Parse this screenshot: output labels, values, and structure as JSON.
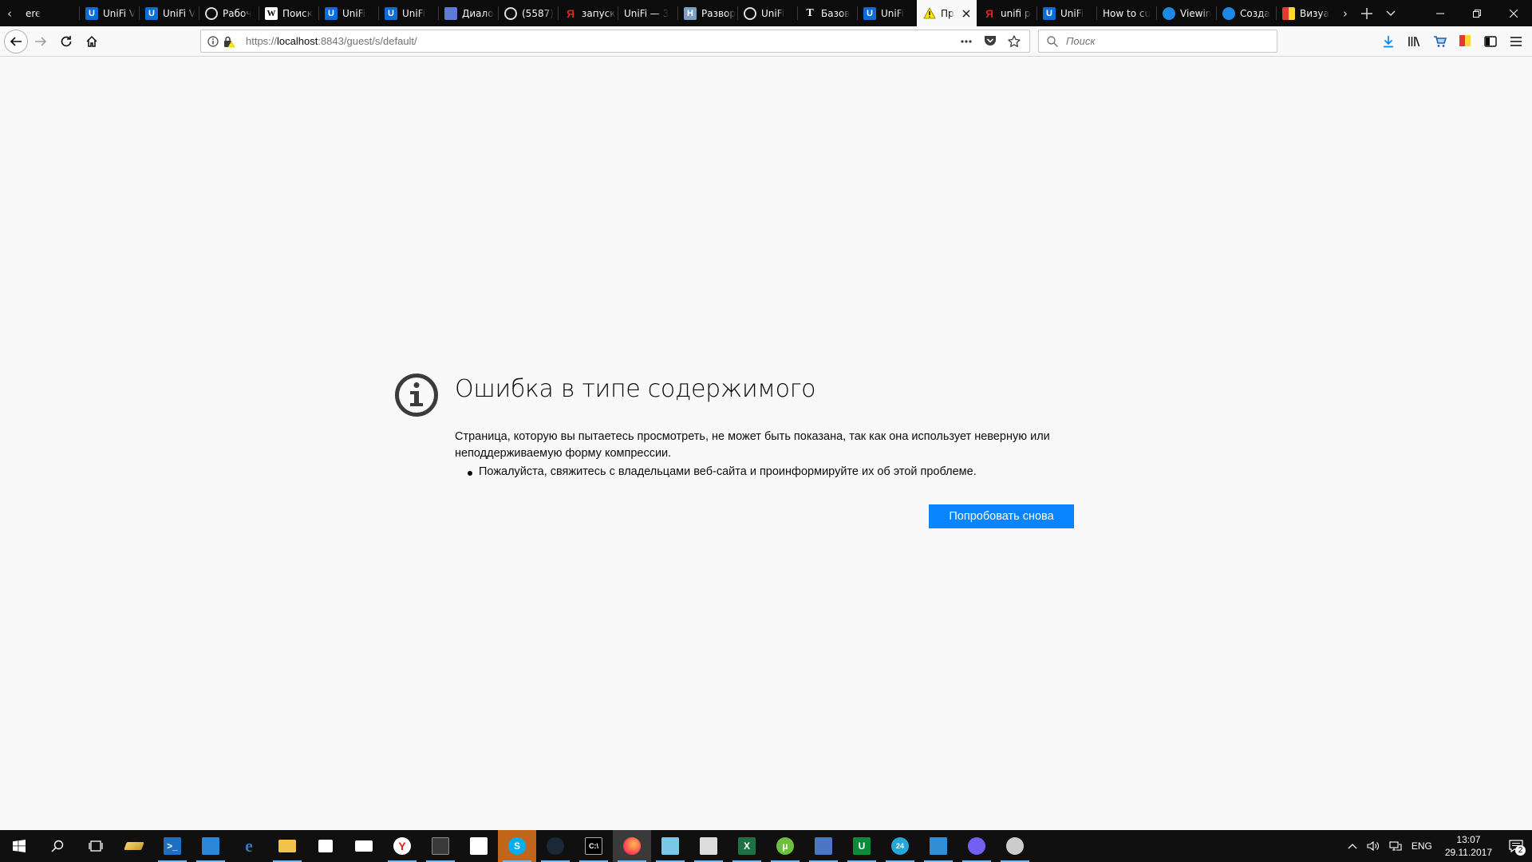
{
  "browser": {
    "tabs": [
      {
        "label": "ere",
        "icon": "none"
      },
      {
        "label": "UniFi V",
        "icon": "unifi"
      },
      {
        "label": "UniFi V",
        "icon": "unifi"
      },
      {
        "label": "Рабоч",
        "icon": "circle"
      },
      {
        "label": "Поиск",
        "icon": "w"
      },
      {
        "label": "UniFi",
        "icon": "unifi"
      },
      {
        "label": "UniFi",
        "icon": "unifi"
      },
      {
        "label": "Диало",
        "icon": "dialog"
      },
      {
        "label": "(5587)",
        "icon": "circle"
      },
      {
        "label": "запуск",
        "icon": "ya"
      },
      {
        "label": "UniFi — 3",
        "icon": "none"
      },
      {
        "label": "Развор",
        "icon": "h"
      },
      {
        "label": "UniFi",
        "icon": "circle"
      },
      {
        "label": "Базов",
        "icon": "t"
      },
      {
        "label": "UniFi",
        "icon": "unifi"
      },
      {
        "label": "Пр",
        "icon": "warn",
        "active": true
      },
      {
        "label": "unifi p",
        "icon": "ya"
      },
      {
        "label": "UniFi",
        "icon": "unifi"
      },
      {
        "label": "How to cu",
        "icon": "none"
      },
      {
        "label": "Viewin",
        "icon": "blue-round"
      },
      {
        "label": "Созда",
        "icon": "blue-round"
      },
      {
        "label": "Визуа",
        "icon": "flag"
      }
    ],
    "url": {
      "prefix": "https://",
      "host": "localhost",
      "rest": ":8843/guest/s/default/"
    },
    "search_placeholder": "Поиск"
  },
  "error_page": {
    "title": "Ошибка в типе содержимого",
    "description": "Страница, которую вы пытаетесь просмотреть, не может быть показана, так как она использует неверную или неподдерживаемую форму компрессии.",
    "items": [
      "Пожалуйста, свяжитесь с владельцами веб-сайта и проинформируйте их об этой проблеме."
    ],
    "retry_button": "Попробовать снова"
  },
  "taskbar": {
    "language": "ENG",
    "time": "13:07",
    "date": "29.11.2017",
    "notification_count": "2"
  },
  "colors": {
    "accent": "#0a84ff",
    "tabbar": "#0c0c0d",
    "page_bg": "#f9f9fa",
    "taskbar": "#101010"
  }
}
